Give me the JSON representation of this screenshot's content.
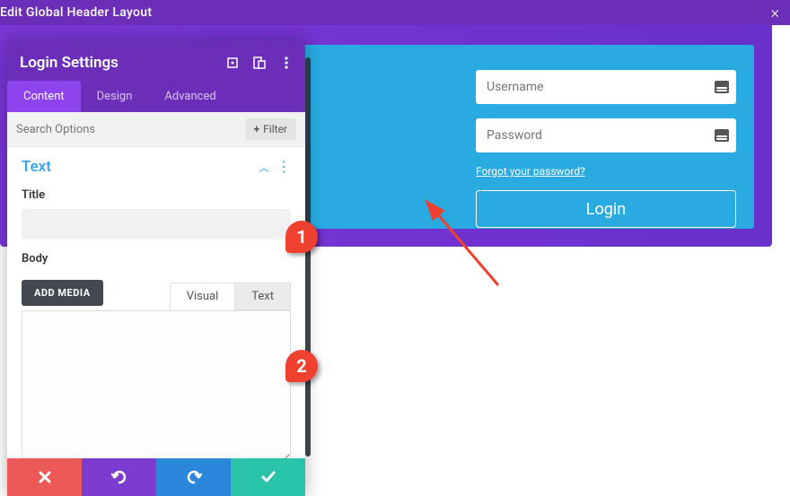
{
  "topbar": {
    "title": "Edit Global Header Layout"
  },
  "panel": {
    "title": "Login Settings",
    "tabs": {
      "content": "Content",
      "design": "Design",
      "advanced": "Advanced",
      "active": "content"
    },
    "search": {
      "placeholder": "Search Options",
      "filter_label": "Filter"
    },
    "section": {
      "title": "Text"
    },
    "fields": {
      "title_label": "Title",
      "title_value": "",
      "body_label": "Body",
      "add_media_label": "ADD MEDIA",
      "editor_tabs": {
        "visual": "Visual",
        "text": "Text",
        "active": "text"
      },
      "body_value": ""
    }
  },
  "preview": {
    "username_placeholder": "Username",
    "password_placeholder": "Password",
    "forgot_label": "Forgot your password?",
    "login_label": "Login"
  },
  "annotations": {
    "m1": "1",
    "m2": "2"
  },
  "colors": {
    "purple": "#6c2eb9",
    "purple_light": "#8e44ec",
    "blue": "#29abe2",
    "link_blue": "#2ea3f2",
    "marker": "#f0402f"
  }
}
